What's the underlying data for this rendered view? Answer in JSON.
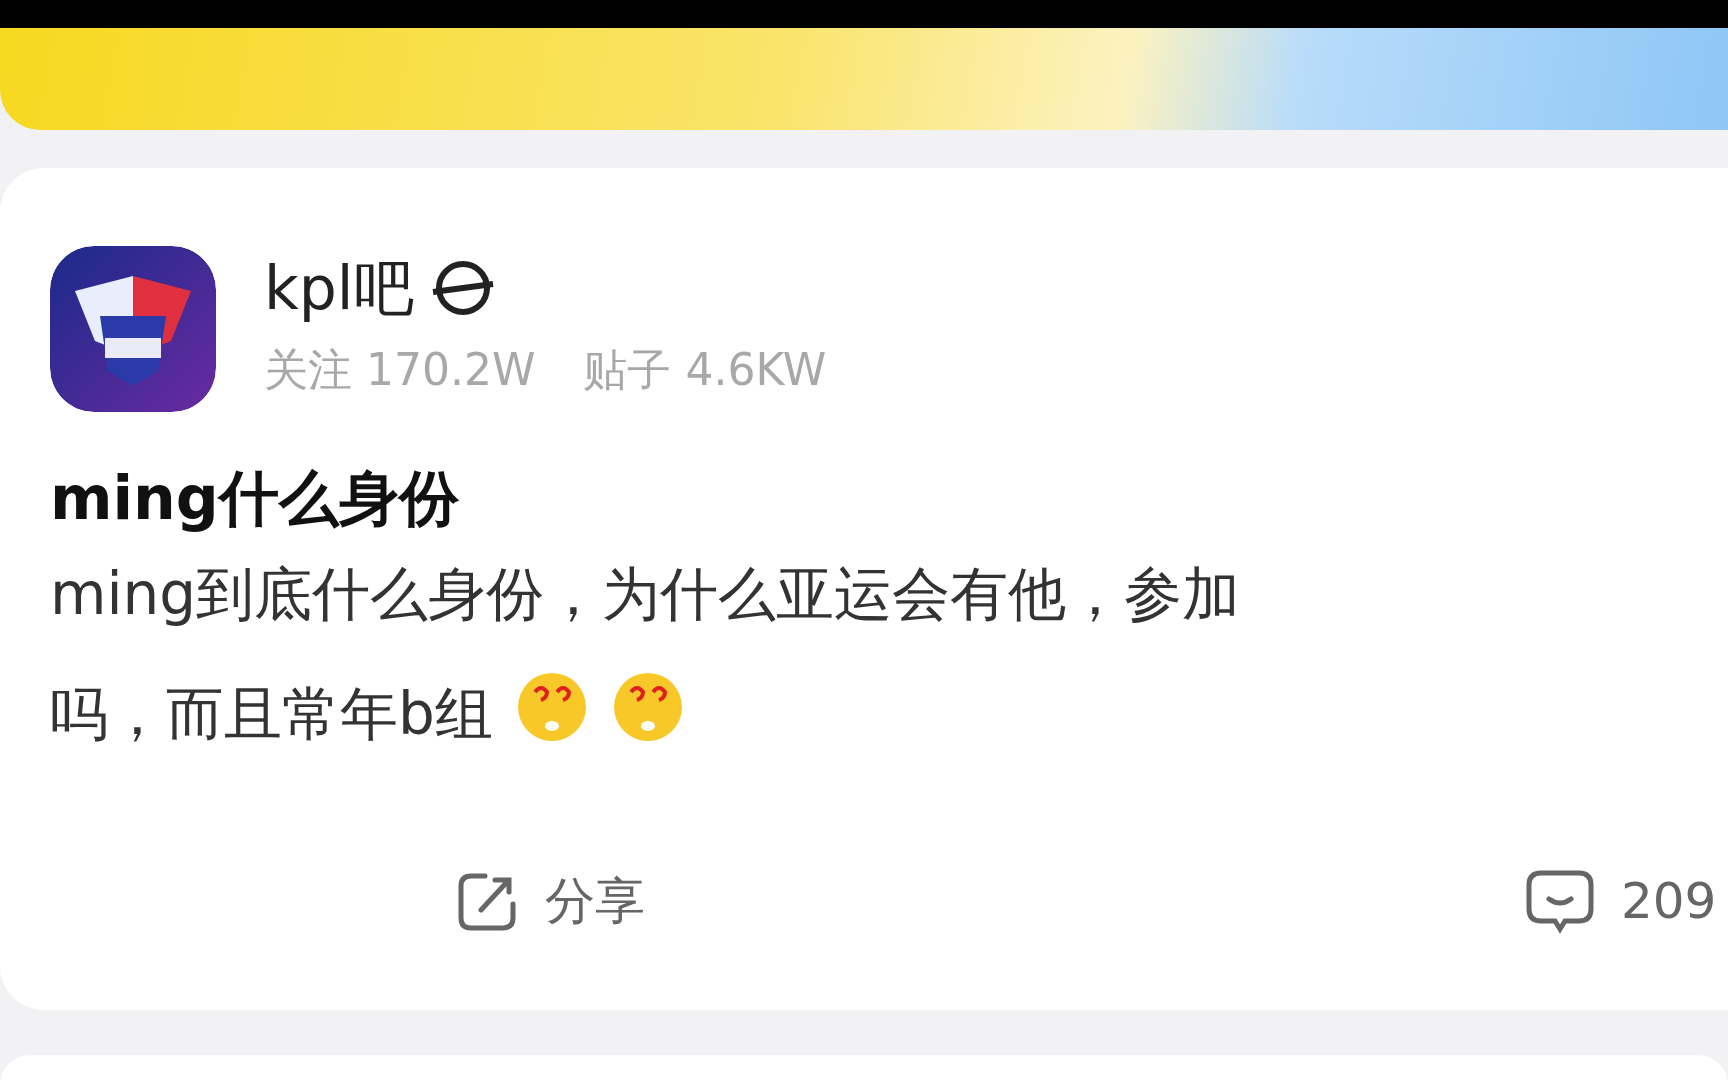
{
  "forum": {
    "name": "kpl吧",
    "stats": [
      {
        "label": "关注",
        "value": "170.2W"
      },
      {
        "label": "贴子",
        "value": "4.6KW"
      }
    ]
  },
  "post": {
    "title": "ming什么身份",
    "lines": [
      "ming到底什么身份，为什么亚运会有他，参加",
      "吗，而且常年b组"
    ],
    "emojis": [
      {
        "kind": "emoji"
      },
      {
        "kind": "emoji"
      }
    ]
  },
  "actions": [
    {
      "kind": "share",
      "label": "分享"
    },
    {
      "kind": "comment",
      "label": "209"
    }
  ]
}
